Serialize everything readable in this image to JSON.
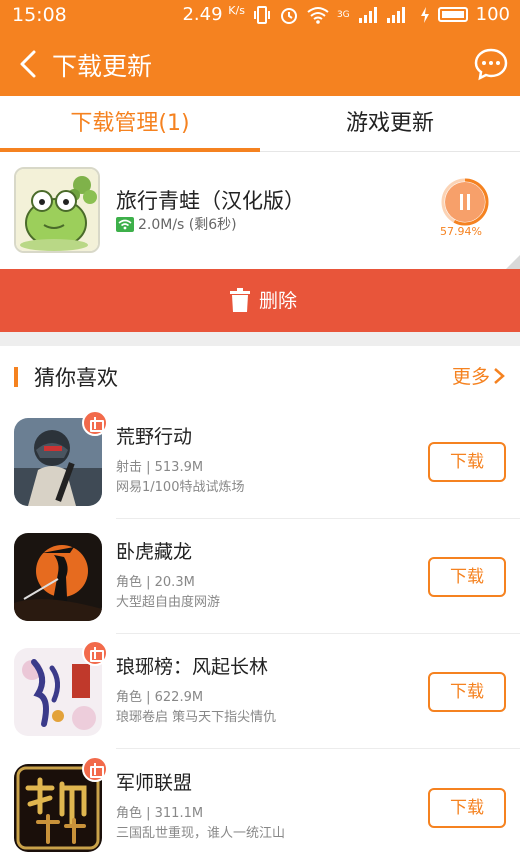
{
  "status_bar": {
    "time": "15:08",
    "speed": "2.49",
    "speed_unit": "K/s",
    "network": "3G",
    "battery": "100"
  },
  "navbar": {
    "title": "下载更新",
    "back_icon": "back-arrow-icon",
    "message_icon": "message-bubble-icon"
  },
  "tabs": [
    {
      "label": "下载管理(1)",
      "active": true
    },
    {
      "label": "游戏更新",
      "active": false
    }
  ],
  "download": {
    "name": "旅行青蛙（汉化版）",
    "speed_text": "2.0M/s (剩6秒)",
    "percent": "57.94%",
    "progress": 0.5794
  },
  "delete_label": "删除",
  "section": {
    "title": "猜你喜欢",
    "more_label": "更多"
  },
  "games": [
    {
      "name": "荒野行动",
      "meta": "射击 | 513.9M",
      "desc": "网易1/100特战试炼场",
      "button": "下载"
    },
    {
      "name": "卧虎藏龙",
      "meta": "角色 | 20.3M",
      "desc": "大型超自由度网游",
      "button": "下载"
    },
    {
      "name": "琅琊榜：风起长林",
      "meta": "角色 | 622.9M",
      "desc": "琅琊卷启 策马天下指尖情仇",
      "button": "下载"
    },
    {
      "name": "军师联盟",
      "meta": "角色 | 311.1M",
      "desc": "三国乱世重现，谁人一统江山",
      "button": "下载"
    }
  ],
  "colors": {
    "accent": "#f58220",
    "delete": "#e8553a",
    "gift": "#f26a4b"
  }
}
